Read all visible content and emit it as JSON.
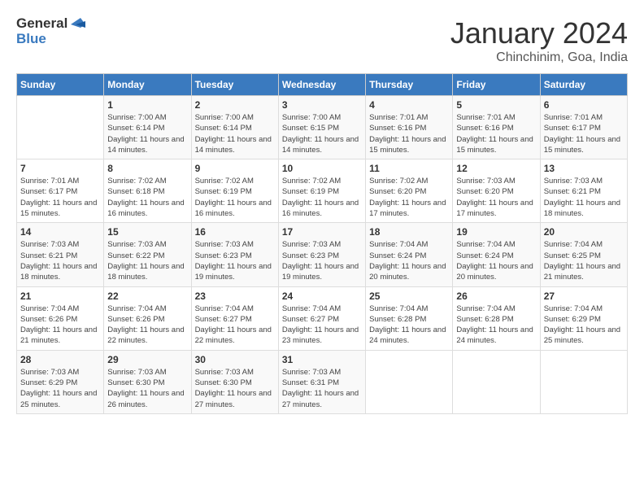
{
  "header": {
    "logo_general": "General",
    "logo_blue": "Blue",
    "month_title": "January 2024",
    "location": "Chinchinim, Goa, India"
  },
  "weekdays": [
    "Sunday",
    "Monday",
    "Tuesday",
    "Wednesday",
    "Thursday",
    "Friday",
    "Saturday"
  ],
  "weeks": [
    [
      {
        "day": "",
        "sunrise": "",
        "sunset": "",
        "daylight": ""
      },
      {
        "day": "1",
        "sunrise": "Sunrise: 7:00 AM",
        "sunset": "Sunset: 6:14 PM",
        "daylight": "Daylight: 11 hours and 14 minutes."
      },
      {
        "day": "2",
        "sunrise": "Sunrise: 7:00 AM",
        "sunset": "Sunset: 6:14 PM",
        "daylight": "Daylight: 11 hours and 14 minutes."
      },
      {
        "day": "3",
        "sunrise": "Sunrise: 7:00 AM",
        "sunset": "Sunset: 6:15 PM",
        "daylight": "Daylight: 11 hours and 14 minutes."
      },
      {
        "day": "4",
        "sunrise": "Sunrise: 7:01 AM",
        "sunset": "Sunset: 6:16 PM",
        "daylight": "Daylight: 11 hours and 15 minutes."
      },
      {
        "day": "5",
        "sunrise": "Sunrise: 7:01 AM",
        "sunset": "Sunset: 6:16 PM",
        "daylight": "Daylight: 11 hours and 15 minutes."
      },
      {
        "day": "6",
        "sunrise": "Sunrise: 7:01 AM",
        "sunset": "Sunset: 6:17 PM",
        "daylight": "Daylight: 11 hours and 15 minutes."
      }
    ],
    [
      {
        "day": "7",
        "sunrise": "Sunrise: 7:01 AM",
        "sunset": "Sunset: 6:17 PM",
        "daylight": "Daylight: 11 hours and 15 minutes."
      },
      {
        "day": "8",
        "sunrise": "Sunrise: 7:02 AM",
        "sunset": "Sunset: 6:18 PM",
        "daylight": "Daylight: 11 hours and 16 minutes."
      },
      {
        "day": "9",
        "sunrise": "Sunrise: 7:02 AM",
        "sunset": "Sunset: 6:19 PM",
        "daylight": "Daylight: 11 hours and 16 minutes."
      },
      {
        "day": "10",
        "sunrise": "Sunrise: 7:02 AM",
        "sunset": "Sunset: 6:19 PM",
        "daylight": "Daylight: 11 hours and 16 minutes."
      },
      {
        "day": "11",
        "sunrise": "Sunrise: 7:02 AM",
        "sunset": "Sunset: 6:20 PM",
        "daylight": "Daylight: 11 hours and 17 minutes."
      },
      {
        "day": "12",
        "sunrise": "Sunrise: 7:03 AM",
        "sunset": "Sunset: 6:20 PM",
        "daylight": "Daylight: 11 hours and 17 minutes."
      },
      {
        "day": "13",
        "sunrise": "Sunrise: 7:03 AM",
        "sunset": "Sunset: 6:21 PM",
        "daylight": "Daylight: 11 hours and 18 minutes."
      }
    ],
    [
      {
        "day": "14",
        "sunrise": "Sunrise: 7:03 AM",
        "sunset": "Sunset: 6:21 PM",
        "daylight": "Daylight: 11 hours and 18 minutes."
      },
      {
        "day": "15",
        "sunrise": "Sunrise: 7:03 AM",
        "sunset": "Sunset: 6:22 PM",
        "daylight": "Daylight: 11 hours and 18 minutes."
      },
      {
        "day": "16",
        "sunrise": "Sunrise: 7:03 AM",
        "sunset": "Sunset: 6:23 PM",
        "daylight": "Daylight: 11 hours and 19 minutes."
      },
      {
        "day": "17",
        "sunrise": "Sunrise: 7:03 AM",
        "sunset": "Sunset: 6:23 PM",
        "daylight": "Daylight: 11 hours and 19 minutes."
      },
      {
        "day": "18",
        "sunrise": "Sunrise: 7:04 AM",
        "sunset": "Sunset: 6:24 PM",
        "daylight": "Daylight: 11 hours and 20 minutes."
      },
      {
        "day": "19",
        "sunrise": "Sunrise: 7:04 AM",
        "sunset": "Sunset: 6:24 PM",
        "daylight": "Daylight: 11 hours and 20 minutes."
      },
      {
        "day": "20",
        "sunrise": "Sunrise: 7:04 AM",
        "sunset": "Sunset: 6:25 PM",
        "daylight": "Daylight: 11 hours and 21 minutes."
      }
    ],
    [
      {
        "day": "21",
        "sunrise": "Sunrise: 7:04 AM",
        "sunset": "Sunset: 6:26 PM",
        "daylight": "Daylight: 11 hours and 21 minutes."
      },
      {
        "day": "22",
        "sunrise": "Sunrise: 7:04 AM",
        "sunset": "Sunset: 6:26 PM",
        "daylight": "Daylight: 11 hours and 22 minutes."
      },
      {
        "day": "23",
        "sunrise": "Sunrise: 7:04 AM",
        "sunset": "Sunset: 6:27 PM",
        "daylight": "Daylight: 11 hours and 22 minutes."
      },
      {
        "day": "24",
        "sunrise": "Sunrise: 7:04 AM",
        "sunset": "Sunset: 6:27 PM",
        "daylight": "Daylight: 11 hours and 23 minutes."
      },
      {
        "day": "25",
        "sunrise": "Sunrise: 7:04 AM",
        "sunset": "Sunset: 6:28 PM",
        "daylight": "Daylight: 11 hours and 24 minutes."
      },
      {
        "day": "26",
        "sunrise": "Sunrise: 7:04 AM",
        "sunset": "Sunset: 6:28 PM",
        "daylight": "Daylight: 11 hours and 24 minutes."
      },
      {
        "day": "27",
        "sunrise": "Sunrise: 7:04 AM",
        "sunset": "Sunset: 6:29 PM",
        "daylight": "Daylight: 11 hours and 25 minutes."
      }
    ],
    [
      {
        "day": "28",
        "sunrise": "Sunrise: 7:03 AM",
        "sunset": "Sunset: 6:29 PM",
        "daylight": "Daylight: 11 hours and 25 minutes."
      },
      {
        "day": "29",
        "sunrise": "Sunrise: 7:03 AM",
        "sunset": "Sunset: 6:30 PM",
        "daylight": "Daylight: 11 hours and 26 minutes."
      },
      {
        "day": "30",
        "sunrise": "Sunrise: 7:03 AM",
        "sunset": "Sunset: 6:30 PM",
        "daylight": "Daylight: 11 hours and 27 minutes."
      },
      {
        "day": "31",
        "sunrise": "Sunrise: 7:03 AM",
        "sunset": "Sunset: 6:31 PM",
        "daylight": "Daylight: 11 hours and 27 minutes."
      },
      {
        "day": "",
        "sunrise": "",
        "sunset": "",
        "daylight": ""
      },
      {
        "day": "",
        "sunrise": "",
        "sunset": "",
        "daylight": ""
      },
      {
        "day": "",
        "sunrise": "",
        "sunset": "",
        "daylight": ""
      }
    ]
  ]
}
